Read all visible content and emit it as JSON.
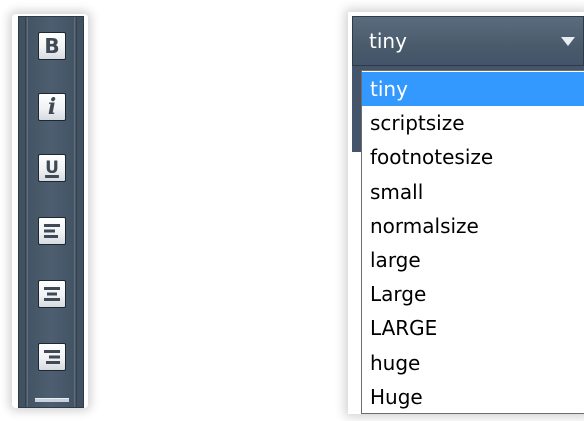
{
  "toolbar": {
    "buttons": [
      {
        "name": "bold",
        "label": "B",
        "icon": "bold-icon"
      },
      {
        "name": "italic",
        "label": "i",
        "icon": "italic-icon"
      },
      {
        "name": "underline",
        "label": "U",
        "icon": "underline-icon"
      },
      {
        "name": "align-left",
        "icon": "align-left-icon"
      },
      {
        "name": "align-center",
        "icon": "align-center-icon"
      },
      {
        "name": "align-right",
        "icon": "align-right-icon"
      }
    ]
  },
  "font_size_dropdown": {
    "selected": "tiny",
    "options": [
      "tiny",
      "scriptsize",
      "footnotesize",
      "small",
      "normalsize",
      "large",
      "Large",
      "LARGE",
      "huge",
      "Huge"
    ],
    "highlighted_index": 0
  },
  "colors": {
    "toolbar_bg": "#4d5e70",
    "dropdown_header_bg": "#4a5b6c",
    "selection": "#3399ff"
  }
}
